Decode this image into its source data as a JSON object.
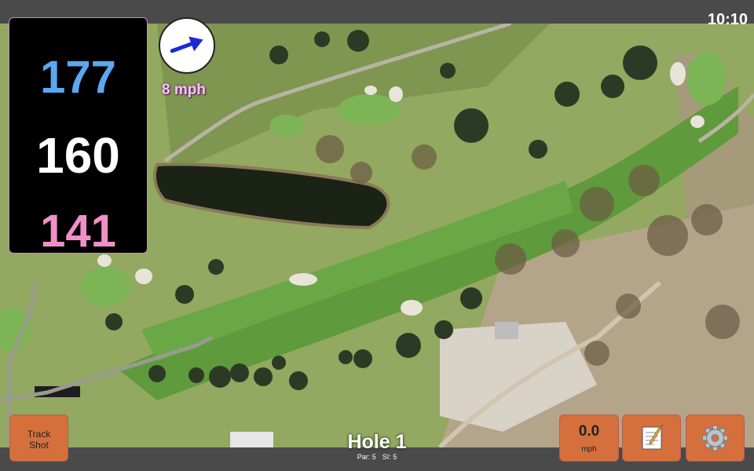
{
  "status": {
    "time": "10:10"
  },
  "yardage": {
    "back": "177",
    "center": "160",
    "front": "141"
  },
  "wind": {
    "speed": "8 mph",
    "icon": "wind-arrow-icon",
    "direction_deg": 60
  },
  "buttons": {
    "track_shot_line1": "Track",
    "track_shot_line2": "Shot",
    "speed_value": "0.0",
    "speed_unit": "mph",
    "notes_icon": "notepad-icon",
    "settings_icon": "gear-icon"
  },
  "hole": {
    "title": "Hole 1",
    "par": "Par: 5",
    "si": "SI: 5"
  },
  "colors": {
    "back": "#5aa8ee",
    "center": "#ffffff",
    "front": "#f090c8",
    "button": "#d5703c"
  }
}
